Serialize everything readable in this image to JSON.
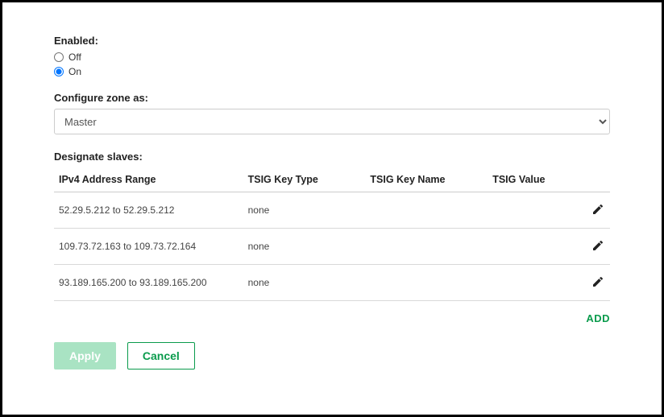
{
  "enabled": {
    "label": "Enabled:",
    "options": {
      "off": "Off",
      "on": "On"
    },
    "selected": "on"
  },
  "configure_zone": {
    "label": "Configure zone as:",
    "selected": "Master"
  },
  "designate_slaves": {
    "label": "Designate slaves:",
    "headers": {
      "ip": "IPv4 Address Range",
      "key_type": "TSIG Key Type",
      "key_name": "TSIG Key Name",
      "key_value": "TSIG Value"
    },
    "rows": [
      {
        "ip": "52.29.5.212 to 52.29.5.212",
        "key_type": "none",
        "key_name": "",
        "key_value": ""
      },
      {
        "ip": "109.73.72.163 to 109.73.72.164",
        "key_type": "none",
        "key_name": "",
        "key_value": ""
      },
      {
        "ip": "93.189.165.200 to 93.189.165.200",
        "key_type": "none",
        "key_name": "",
        "key_value": ""
      }
    ]
  },
  "actions": {
    "add": "ADD",
    "apply": "Apply",
    "cancel": "Cancel"
  }
}
